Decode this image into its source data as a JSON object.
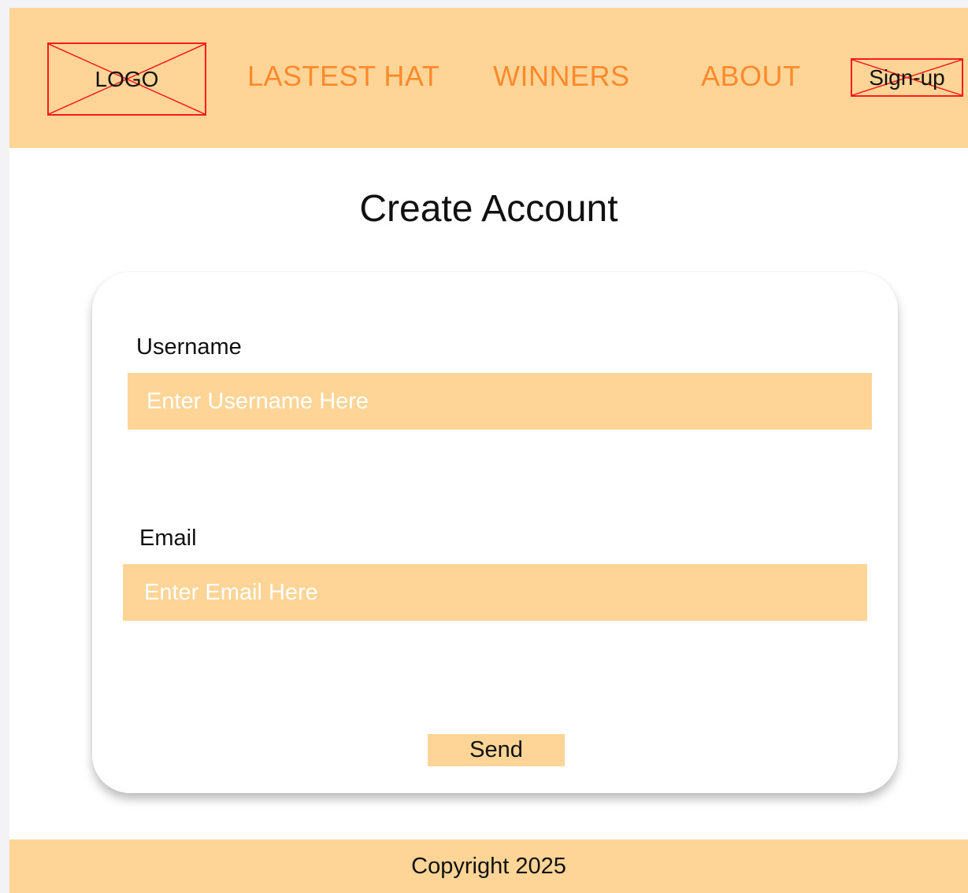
{
  "header": {
    "logo_label": "LOGO",
    "nav": [
      {
        "label": "LASTEST HAT"
      },
      {
        "label": "WINNERS"
      },
      {
        "label": "ABOUT"
      }
    ],
    "signup_label": "Sign-up"
  },
  "main": {
    "title": "Create Account",
    "form": {
      "username_label": "Username",
      "username_placeholder": "Enter Username Here",
      "email_label": "Email",
      "email_placeholder": "Enter Email Here",
      "submit_label": "Send"
    }
  },
  "footer": {
    "copyright": "Copyright 2025"
  },
  "colors": {
    "header_bg": "#fed597",
    "nav_text": "#ff8a2b",
    "placeholder_border": "#ff1b1b",
    "input_bg": "#fed597"
  },
  "icons": {
    "logo_placeholder": "image-placeholder-icon",
    "signup_placeholder": "image-placeholder-icon"
  }
}
